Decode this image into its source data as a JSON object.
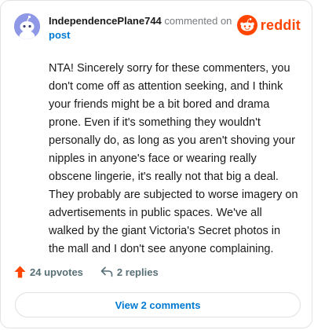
{
  "comment": {
    "username": "IndependencePlane744",
    "action_text": "commented on",
    "target": "post",
    "body": "NTA! Sincerely sorry for these commenters, you don't come off as attention seeking, and I think your friends might be a bit bored and drama prone. Even if it's something they wouldn't personally do, as long as you aren't shoving your nipples in anyone's face or wearing really obscene lingerie, it's really not that big a deal. They probably are subjected to worse imagery on advertisements in public spaces. We've all walked by the giant Victoria's Secret photos in the mall and I don't see anyone complaining."
  },
  "brand": {
    "name": "reddit",
    "icon": "reddit-snoo-icon",
    "color": "#ff4500"
  },
  "stats": {
    "upvotes": "24 upvotes",
    "upvote_icon": "upvote-arrow-icon",
    "replies": "2 replies",
    "reply_icon": "reply-arrow-icon"
  },
  "view_comments_label": "View 2 comments",
  "colors": {
    "accent": "#ff4500",
    "link": "#0079d3",
    "avatar": "#8e98e6"
  }
}
